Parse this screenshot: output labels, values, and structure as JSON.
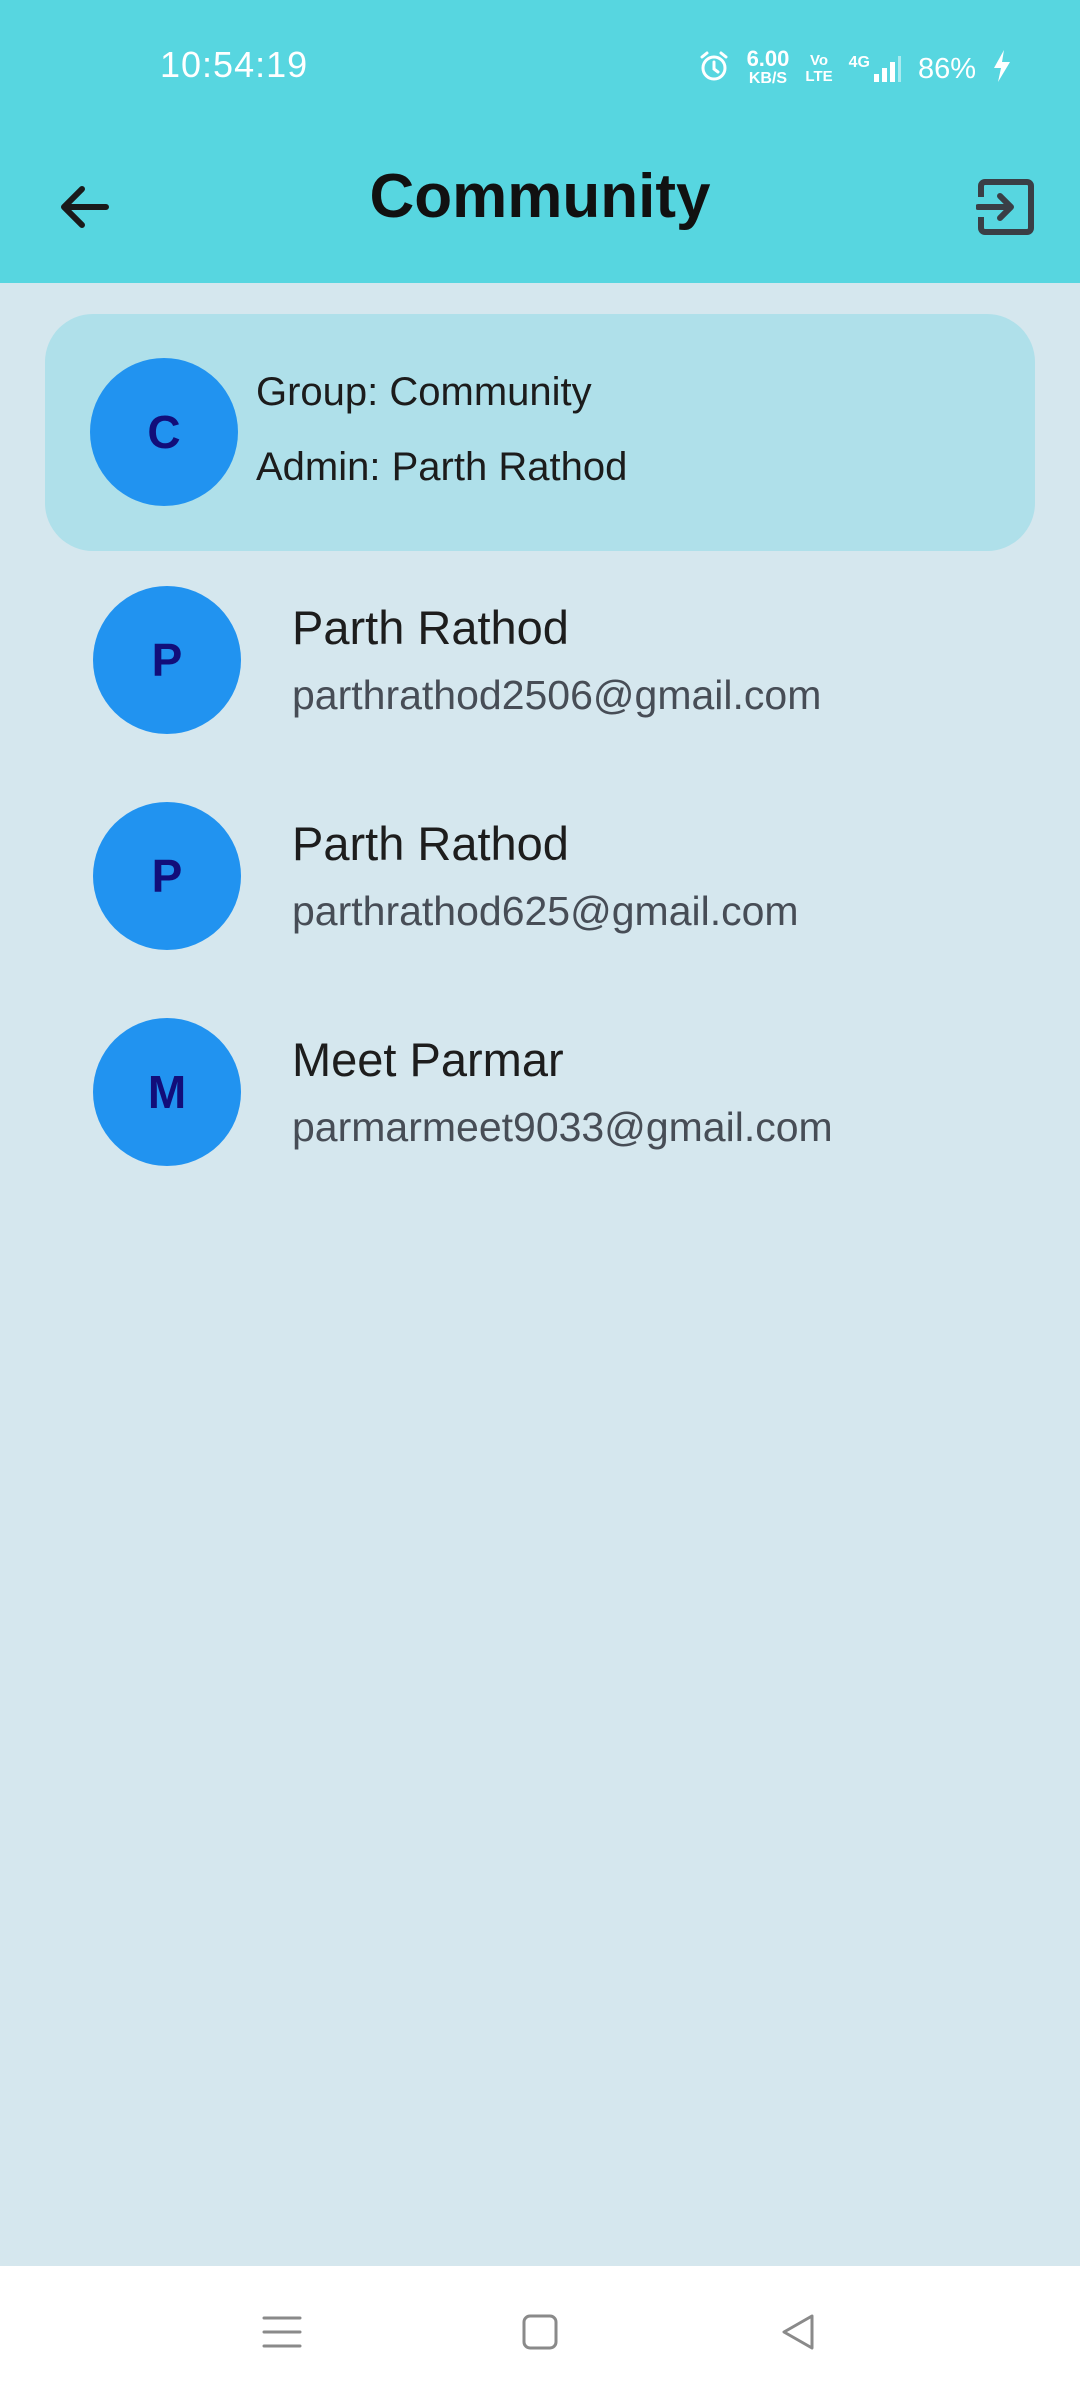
{
  "status_bar": {
    "time": "10:54:19",
    "speed_value": "6.00",
    "speed_unit": "KB/S",
    "volte_top": "Vo",
    "volte_bottom": "LTE",
    "network": "4G",
    "battery": "86%"
  },
  "app_bar": {
    "title": "Community",
    "back_icon": "arrow-left-icon",
    "exit_icon": "exit-to-app-icon"
  },
  "group": {
    "avatar_letter": "C",
    "group_text": "Group: Community",
    "admin_text": "Admin: Parth Rathod"
  },
  "members": [
    {
      "avatar_letter": "P",
      "name": "Parth Rathod",
      "email": "parthrathod2506@gmail.com"
    },
    {
      "avatar_letter": "P",
      "name": "Parth Rathod",
      "email": "parthrathod625@gmail.com"
    },
    {
      "avatar_letter": "M",
      "name": "Meet Parmar",
      "email": "parmarmeet9033@gmail.com"
    }
  ],
  "colors": {
    "app_bar": "#57d6e0",
    "background": "#d5e7ee",
    "card": "#afe0ea",
    "avatar": "#2193f0",
    "avatar_letter": "#120e7a"
  },
  "nav_bar": {
    "menu_icon": "menu-icon",
    "home_icon": "square-home-icon",
    "back_icon": "triangle-back-icon"
  }
}
